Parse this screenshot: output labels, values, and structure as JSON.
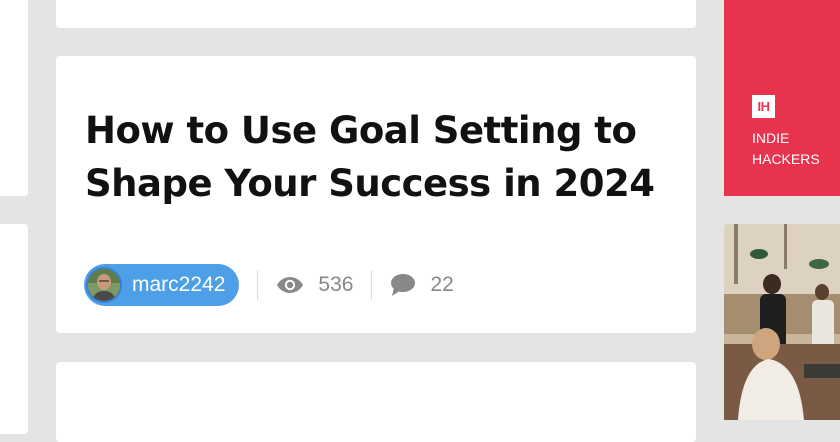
{
  "post": {
    "title": "How to Use Goal Setting to Shape Your Success in 2024",
    "author": {
      "username": "marc2242",
      "avatar_icon": "user-avatar"
    },
    "stats": {
      "views": "536",
      "comments": "22"
    }
  },
  "sidebar_ad": {
    "logo_text": "IH",
    "brand_name": "INDIE\nHACKERS",
    "background": "#e8334f"
  },
  "colors": {
    "accent": "#4d9fe8",
    "page_background": "#e4e4e4",
    "muted": "#888888"
  },
  "icons": {
    "views": "eye-icon",
    "comments": "speech-bubble-icon"
  }
}
